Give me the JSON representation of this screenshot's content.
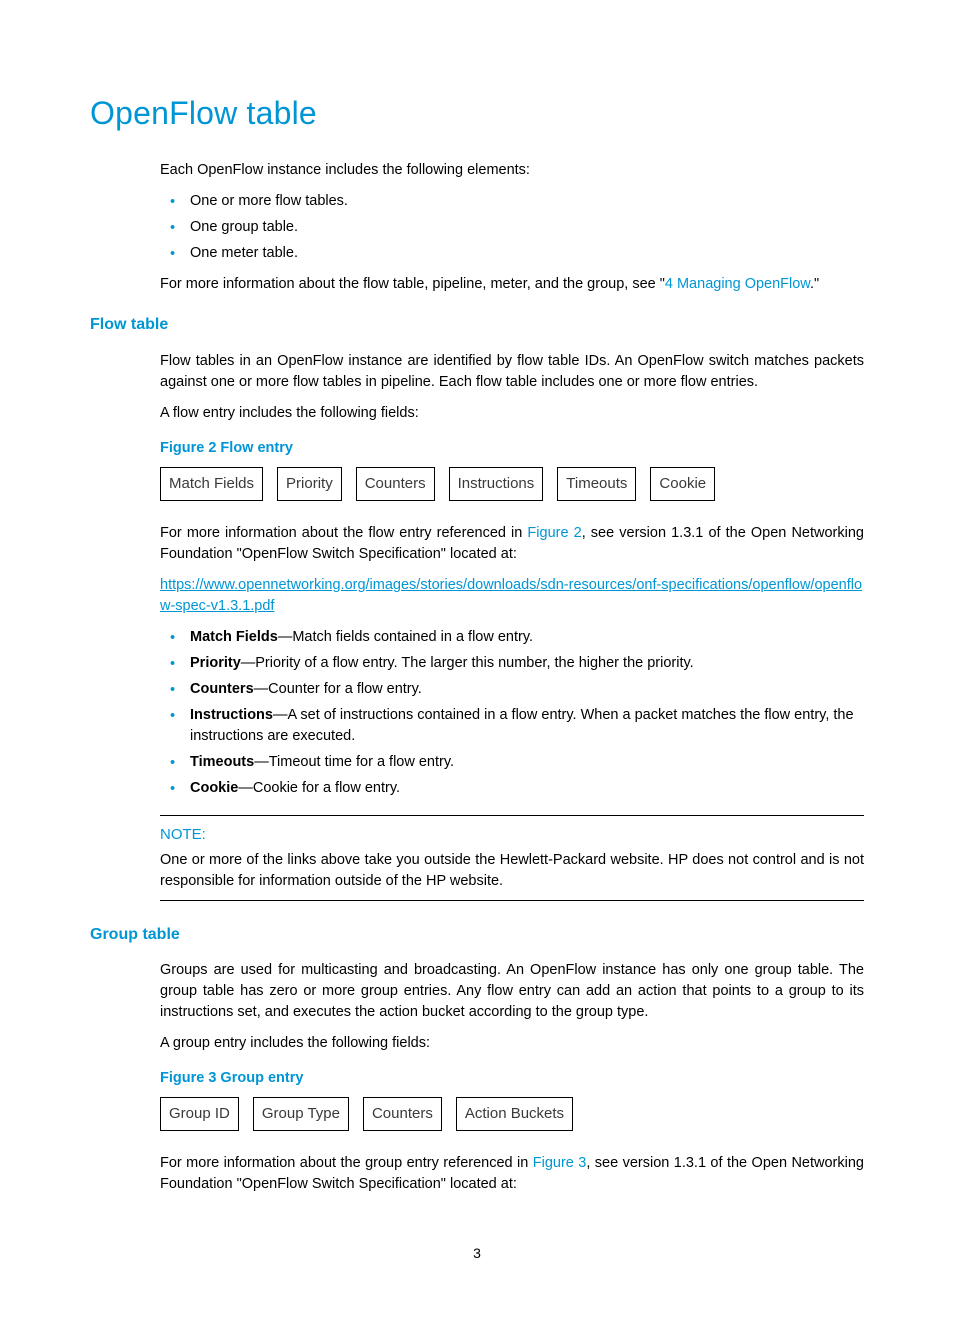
{
  "h1": "OpenFlow table",
  "intro": "Each OpenFlow instance includes the following elements:",
  "intro_bullets": [
    "One or more flow tables.",
    "One group table.",
    "One meter table."
  ],
  "more_info_prefix": "For more information about the flow table, pipeline, meter, and the group, see \"",
  "more_info_link": "4 Managing OpenFlow",
  "more_info_suffix": ".\"",
  "flow_table": {
    "heading": "Flow table",
    "p1": "Flow tables in an OpenFlow instance are identified by flow table IDs. An OpenFlow switch matches packets against one or more flow tables in pipeline. Each flow table includes one or more flow entries.",
    "p2": "A flow entry includes the following fields:",
    "figure_caption": "Figure 2 Flow entry",
    "diagram": [
      "Match Fields",
      "Priority",
      "Counters",
      "Instructions",
      "Timeouts",
      "Cookie"
    ],
    "p3_a": "For more information about the flow entry referenced in ",
    "p3_link": "Figure 2",
    "p3_b": ", see version 1.3.1 of the Open Networking Foundation \"OpenFlow Switch Specification\" located at:",
    "spec_url": "https://www.opennetworking.org/images/stories/downloads/sdn-resources/onf-specifications/openflow/openflow-spec-v1.3.1.pdf",
    "fields": [
      {
        "term": "Match Fields",
        "desc": "—Match fields contained in a flow entry."
      },
      {
        "term": "Priority",
        "desc": "—Priority of a flow entry. The larger this number, the higher the priority."
      },
      {
        "term": "Counters",
        "desc": "—Counter for a flow entry."
      },
      {
        "term": "Instructions",
        "desc": "—A set of instructions contained in a flow entry. When a packet matches the flow entry, the instructions are executed."
      },
      {
        "term": "Timeouts",
        "desc": "—Timeout time for a flow entry."
      },
      {
        "term": "Cookie",
        "desc": "—Cookie for a flow entry."
      }
    ],
    "note_title": "NOTE:",
    "note_body": "One or more of the links above take you outside the Hewlett-Packard website. HP does not control and is not responsible for information outside of the HP website."
  },
  "group_table": {
    "heading": "Group table",
    "p1": "Groups are used for multicasting and broadcasting. An OpenFlow instance has only one group table. The group table has zero or more group entries. Any flow entry can add an action that points to a group to its instructions set, and executes the action bucket according to the group type.",
    "p2": "A group entry includes the following fields:",
    "figure_caption": "Figure 3 Group entry",
    "diagram": [
      "Group ID",
      "Group Type",
      "Counters",
      "Action Buckets"
    ],
    "p3_a": "For more information about the group entry referenced in ",
    "p3_link": "Figure 3",
    "p3_b": ", see version 1.3.1 of the Open Networking Foundation \"OpenFlow Switch Specification\" located at:"
  },
  "page_number": "3"
}
